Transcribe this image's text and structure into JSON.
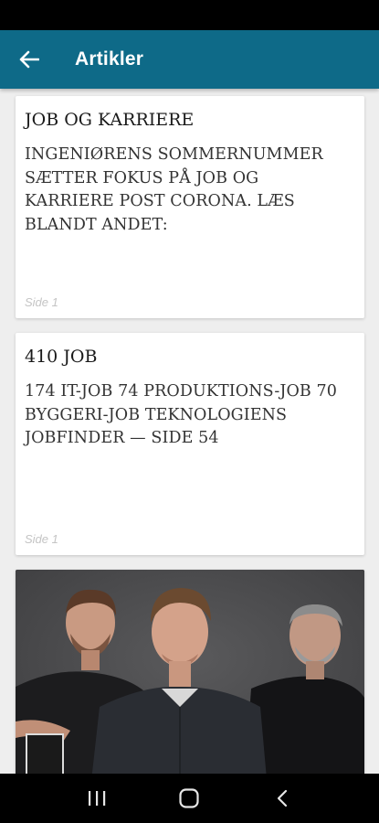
{
  "app_bar": {
    "title": "Artikler",
    "back_icon": "arrow-left-icon",
    "background": "#0e6a88"
  },
  "articles": [
    {
      "title": "JOB OG KARRIERE",
      "excerpt": "INGENIØRENS SOMMERNUMMER SÆTTER FOKUS PÅ JOB OG KARRIERE POST CORONA. LÆS BLANDT ANDET:",
      "page": "Side 1"
    },
    {
      "title": "410 JOB",
      "excerpt": "174 IT-JOB 74 PRODUKTIONS-JOB 70 BYGGERI-JOB TEKNOLOGIENS JOBFINDER — SIDE 54",
      "page": "Side 1"
    },
    {
      "image": "photo-three-men"
    }
  ],
  "nav_bar": {
    "recents_icon": "recents-icon",
    "home_icon": "home-icon",
    "back_icon": "chevron-left-icon"
  }
}
